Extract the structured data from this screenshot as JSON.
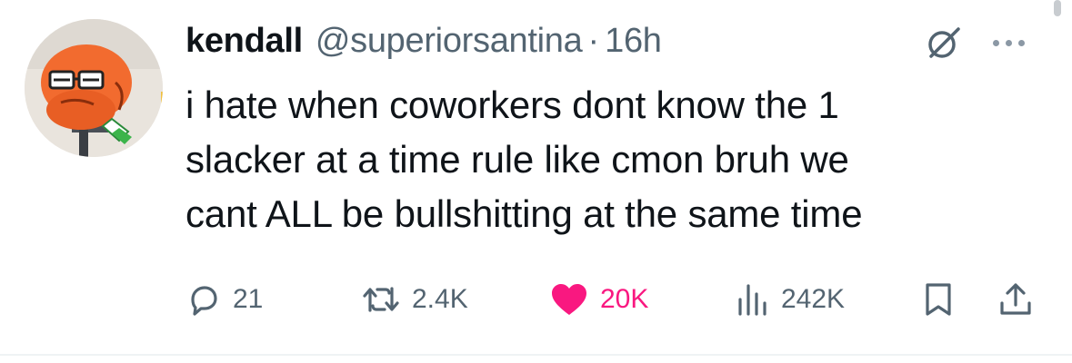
{
  "tweet": {
    "author": {
      "name": "kendall",
      "handle": "@superiorsantina",
      "separator": "·",
      "time": "16h"
    },
    "text_lines": [
      "i hate when coworkers dont know the 1",
      "slacker at a time rule like cmon bruh we",
      "cant ALL be bullshitting at the same time"
    ],
    "stats": {
      "replies": "21",
      "reposts": "2.4K",
      "likes": "20K",
      "views": "242K"
    },
    "liked": true,
    "colors": {
      "like": "#f91880",
      "muted": "#536471",
      "text": "#0f1419"
    },
    "icons": [
      "grok-icon",
      "more-icon",
      "reply-icon",
      "retweet-icon",
      "heart-icon",
      "views-icon",
      "bookmark-icon",
      "share-icon"
    ]
  }
}
